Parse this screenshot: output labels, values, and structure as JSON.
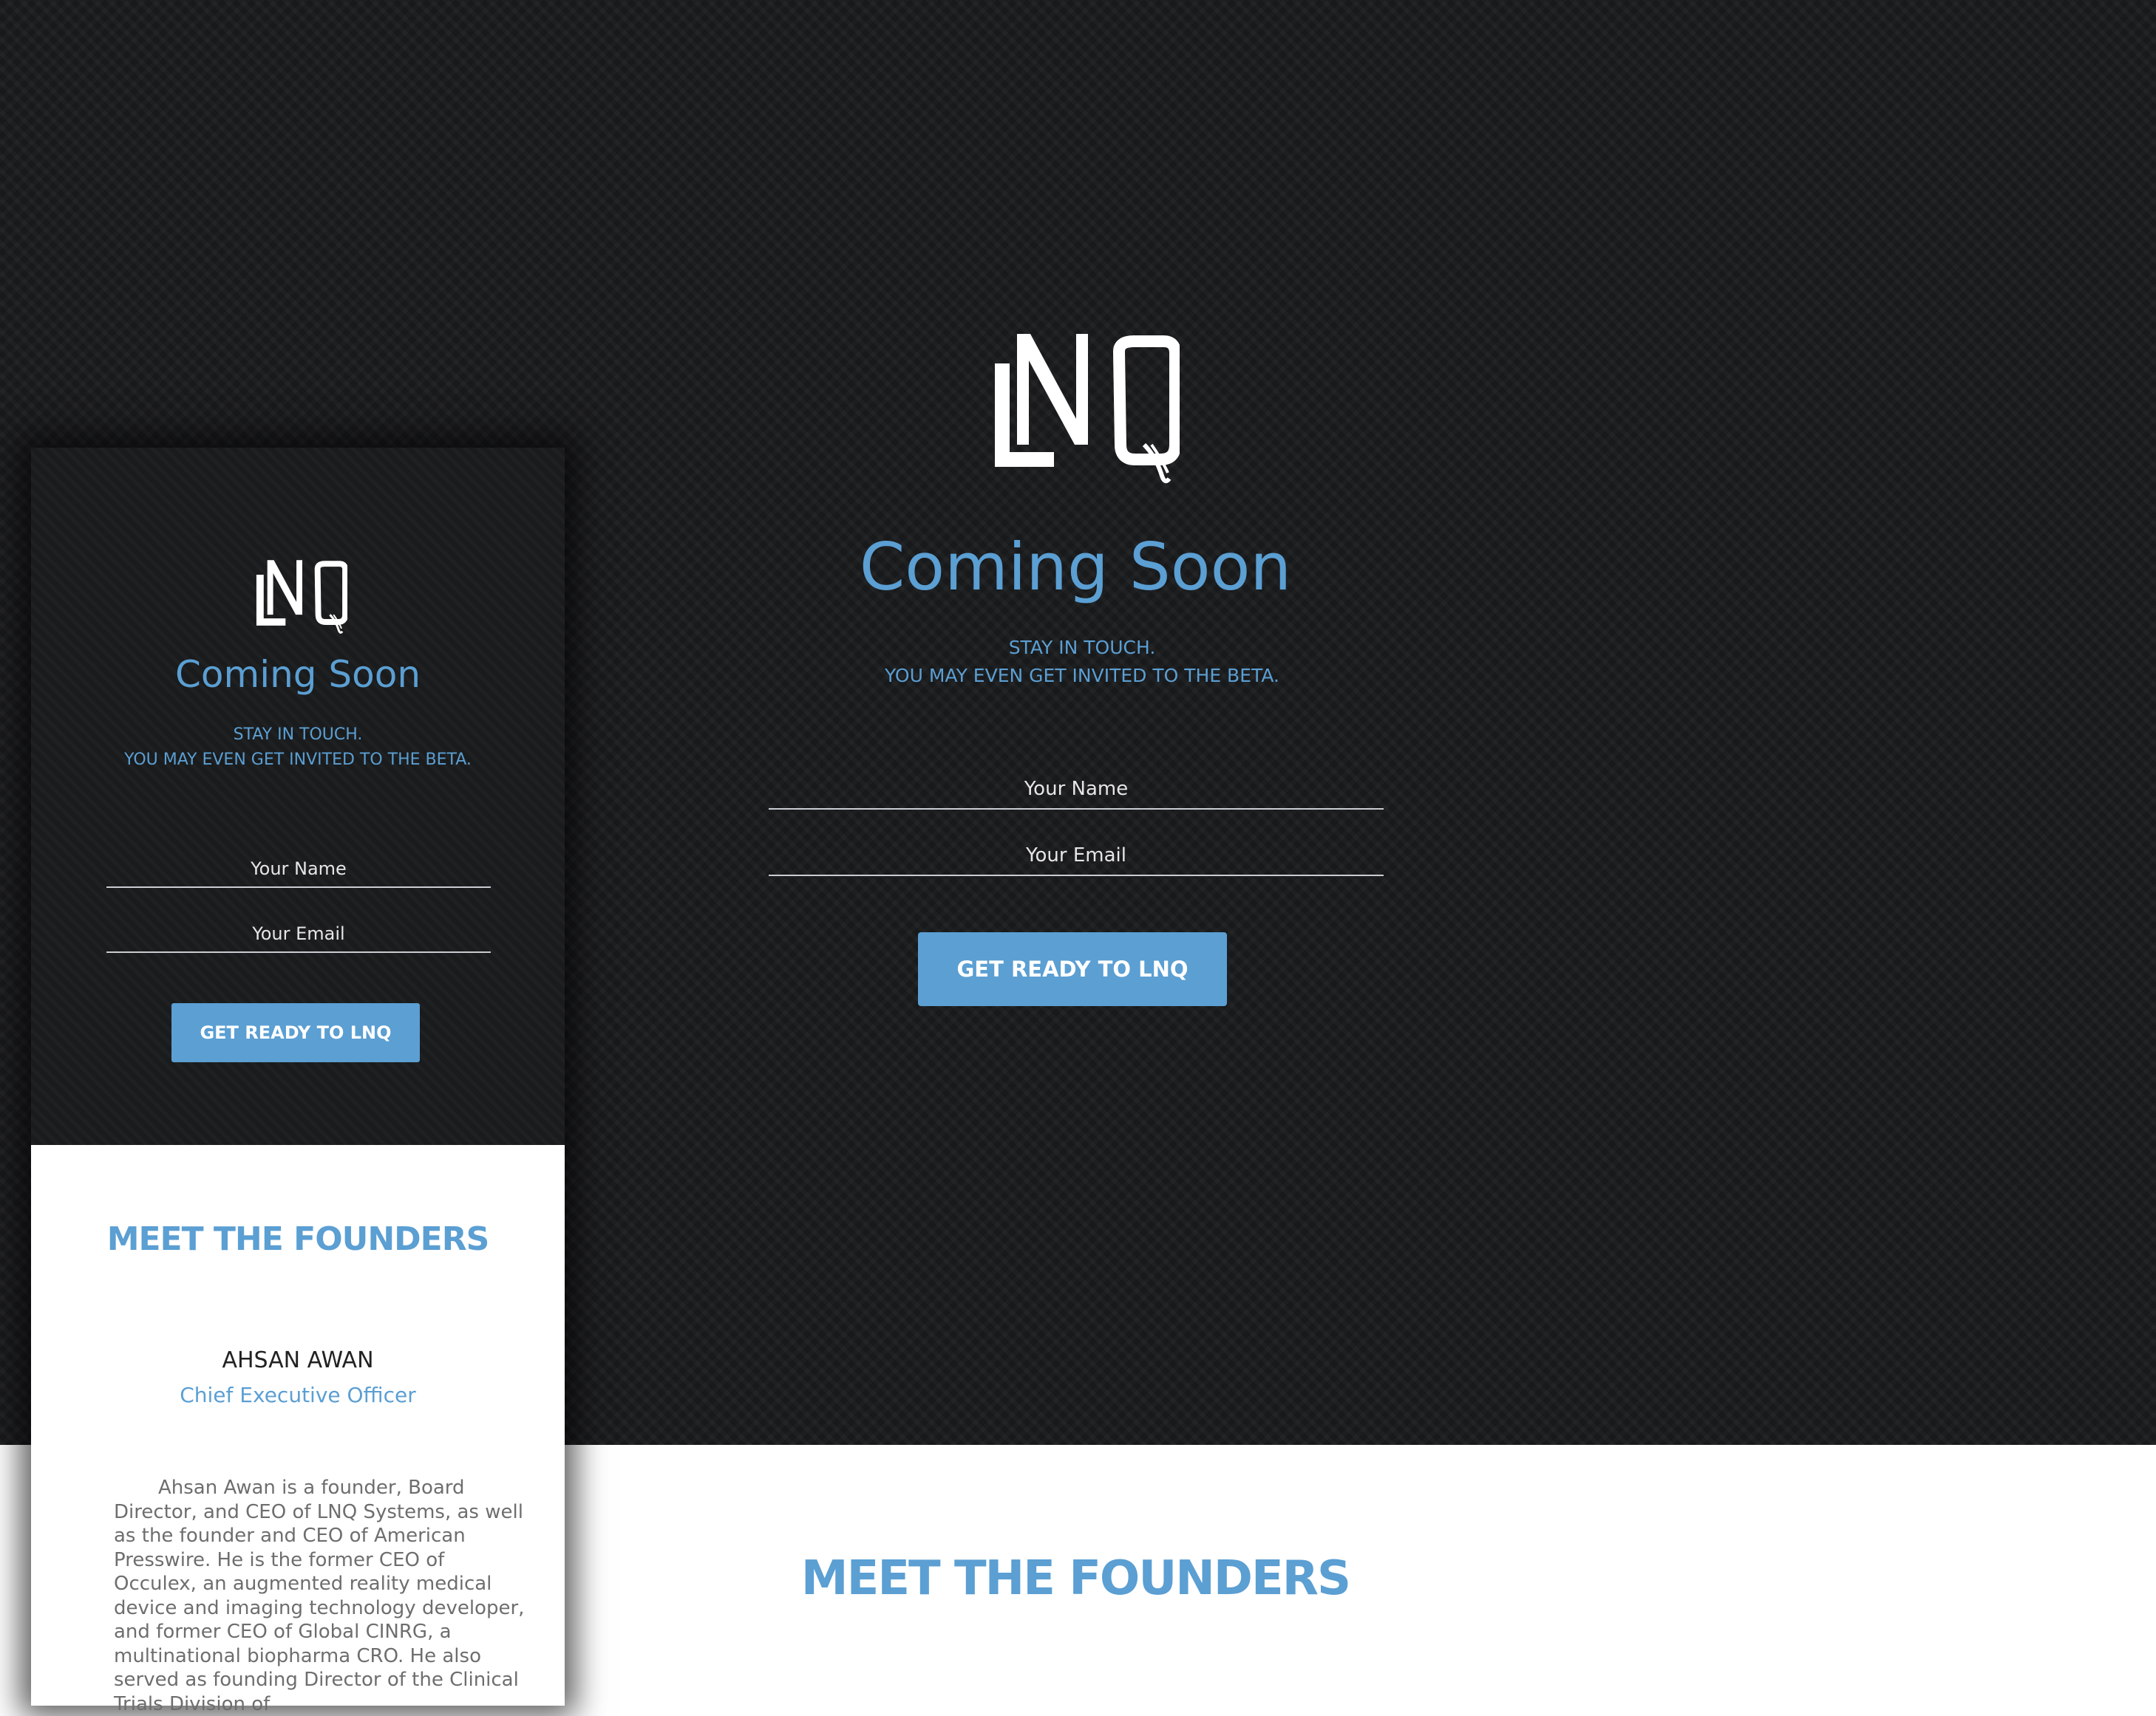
{
  "brand": {
    "logo_text": "LNQ",
    "accent_color": "#5b9fd3",
    "background_color": "#1a1b1d"
  },
  "desktop": {
    "title": "Coming Soon",
    "subtitle_line1": "STAY IN TOUCH.",
    "subtitle_line2": "YOU MAY EVEN GET INVITED TO THE BETA.",
    "name_placeholder": "Your Name",
    "email_placeholder": "Your Email",
    "cta_label": "GET READY TO LNQ",
    "founders_heading": "MEET THE FOUNDERS"
  },
  "mobile": {
    "title": "Coming Soon",
    "subtitle_line1": "STAY IN TOUCH.",
    "subtitle_line2": "YOU MAY EVEN GET INVITED TO THE BETA.",
    "name_placeholder": "Your Name",
    "email_placeholder": "Your Email",
    "cta_label": "GET READY TO LNQ",
    "founders_heading": "MEET THE FOUNDERS",
    "founder": {
      "name": "AHSAN AWAN",
      "role": "Chief Executive Officer",
      "bio": "Ahsan Awan is a founder, Board Director, and CEO of LNQ Systems, as well as the founder and CEO of American Presswire. He is the former CEO of Occulex, an augmented reality medical device and imaging technology developer, and former CEO of Global CINRG, a multinational biopharma CRO. He also served as founding Director of the Clinical Trials Division of"
    }
  }
}
